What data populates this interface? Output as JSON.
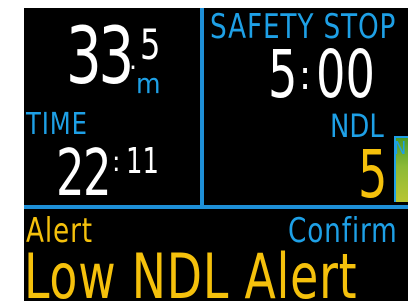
{
  "depth": {
    "value": "33",
    "decimal": "5",
    "separator": ".",
    "unit": "m"
  },
  "time": {
    "label": "TIME",
    "hours": "22",
    "separator": ":",
    "minutes": "11"
  },
  "safety_stop": {
    "label": "SAFETY STOP",
    "minutes": "5",
    "separator": ":",
    "seconds": "00"
  },
  "ndl": {
    "label": "NDL",
    "value": "5",
    "bar_label": "N"
  },
  "alert": {
    "label": "Alert",
    "confirm_label": "Confirm",
    "message": "Low NDL Alert"
  },
  "colors": {
    "background": "#000000",
    "primary_text": "#ffffff",
    "accent_blue": "#1ea0e6",
    "alert_gold": "#f5c10c",
    "ndl_bar": "#8cba36"
  }
}
